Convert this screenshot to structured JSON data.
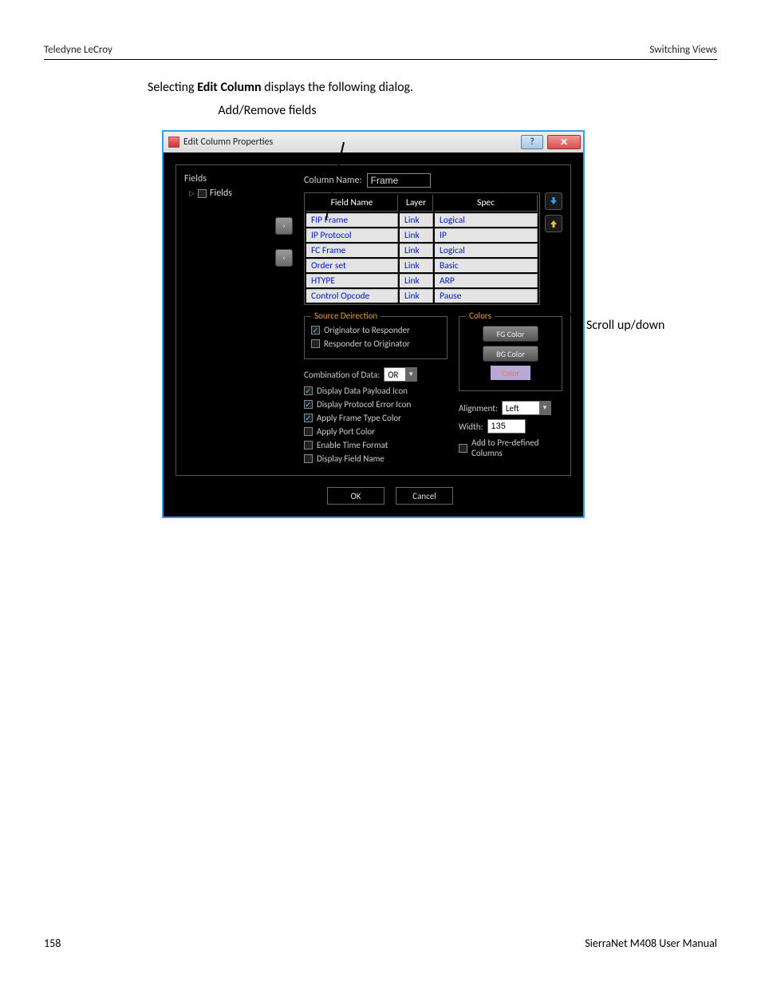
{
  "header": {
    "left": "Teledyne LeCroy",
    "right": "Switching Views"
  },
  "intro": {
    "pre": "Selecting ",
    "bold": "Edit Column",
    "post": " displays the following dialog."
  },
  "callouts": {
    "top": "Add/Remove fields",
    "right": "Scroll up/down"
  },
  "dialog": {
    "title": "Edit Column Properties",
    "tree": {
      "root": "Fields",
      "child": "Fields"
    },
    "column_name_label": "Column Name:",
    "column_name_value": "Frame",
    "table": {
      "headers": [
        "Field Name",
        "Layer",
        "Spec"
      ],
      "rows": [
        [
          "FIP Frame",
          "Link",
          "Logical"
        ],
        [
          "IP Protocol",
          "Link",
          "IP"
        ],
        [
          "FC Frame",
          "Link",
          "Logical"
        ],
        [
          "Order set",
          "Link",
          "Basic"
        ],
        [
          "HTYPE",
          "Link",
          "ARP"
        ],
        [
          "Control Opcode",
          "Link",
          "Pause"
        ]
      ]
    },
    "source_dir": {
      "legend": "Source Deirection",
      "o2r": "Originator to Responder",
      "r2o": "Responder to Originator"
    },
    "colors": {
      "legend": "Colors",
      "fg": "FG Color",
      "bg": "BG Color",
      "sample": "Color"
    },
    "options": {
      "combo_label": "Combination of Data:",
      "combo_value": "OR",
      "items": [
        {
          "label": "Display Data Payload Icon",
          "checked": true
        },
        {
          "label": "Display Protocol Error Icon",
          "checked": true
        },
        {
          "label": "Apply Frame Type Color",
          "checked": true
        },
        {
          "label": "Apply Port Color",
          "checked": false
        },
        {
          "label": "Enable Time Format",
          "checked": false
        },
        {
          "label": "Display Field Name",
          "checked": false
        }
      ]
    },
    "align_label": "Alignment:",
    "align_value": "Left",
    "width_label": "Width:",
    "width_value": "135",
    "predef": "Add to Pre-defined Columns",
    "ok": "OK",
    "cancel": "Cancel"
  },
  "footer": {
    "page": "158",
    "right": "SierraNet M408 User Manual"
  }
}
